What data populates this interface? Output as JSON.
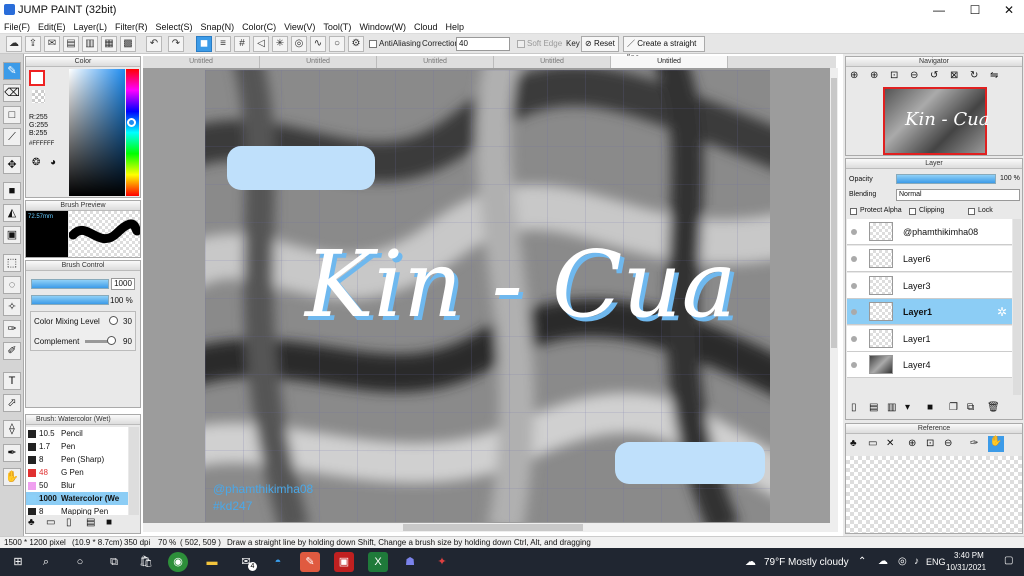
{
  "window": {
    "title": "JUMP PAINT (32bit)",
    "minimize": "—",
    "maximize": "☐",
    "close": "✕"
  },
  "menu": [
    "File(F)",
    "Edit(E)",
    "Layer(L)",
    "Filter(R)",
    "Select(S)",
    "Snap(N)",
    "Color(C)",
    "View(V)",
    "Tool(T)",
    "Window(W)",
    "Cloud",
    "Help"
  ],
  "toolbar": {
    "antialiasing_label": "AntiAliasing",
    "correction_label": "Correction",
    "correction_value": "40",
    "soft_edge_label": "Soft Edge",
    "key_label": "Key",
    "reset_label": "Reset",
    "straight_line_label": "Create a straight line"
  },
  "color_panel": {
    "title": "Color",
    "r": "R:255",
    "g": "G:255",
    "b": "B:255",
    "hex": "#FFFFFF"
  },
  "brush_preview": {
    "title": "Brush Preview",
    "size": "72.57mm"
  },
  "brush_control": {
    "title": "Brush Control",
    "size_value": "1000",
    "opacity_value": "100 %",
    "color_mixing_label": "Color Mixing Level",
    "color_mixing_value": "30",
    "complement_label": "Complement",
    "complement_value": "90"
  },
  "brush_list": {
    "title": "Brush: Watercolor (Wet)",
    "items": [
      {
        "size": "10.5",
        "name": "Pencil",
        "color": "#222222"
      },
      {
        "size": "1.7",
        "name": "Pen",
        "color": "#222222"
      },
      {
        "size": "8",
        "name": "Pen (Sharp)",
        "color": "#222222"
      },
      {
        "size": "48",
        "name": "G Pen",
        "color": "#e03030"
      },
      {
        "size": "50",
        "name": "Blur",
        "color": "#f0a0f0"
      },
      {
        "size": "1000",
        "name": "Watercolor (We",
        "color": "#8cd0f8"
      },
      {
        "size": "8",
        "name": "Mapping Pen",
        "color": "#222222"
      }
    ]
  },
  "tabs": [
    "Untitled",
    "Untitled",
    "Untitled",
    "Untitled",
    "Untitled"
  ],
  "artwork": {
    "main_text": "Kin - Cua",
    "credit_1": "@phamthikimha08",
    "credit_2": "#kd247"
  },
  "navigator": {
    "title": "Navigator",
    "thumb_text": "Kin - Cua"
  },
  "layer_panel": {
    "title": "Layer",
    "opacity_label": "Opacity",
    "opacity_value": "100 %",
    "blending_label": "Blending",
    "blending_value": "Normal",
    "protect_alpha": "Protect Alpha",
    "clipping": "Clipping",
    "lock": "Lock",
    "layers": [
      "@phamthikimha08",
      "Layer6",
      "Layer3",
      "Layer1",
      "Layer1",
      "Layer4"
    ]
  },
  "reference": {
    "title": "Reference"
  },
  "status": {
    "size": "1500 * 1200 pixel",
    "physical": "(10.9 * 8.7cm)",
    "dpi": "350 dpi",
    "zoom": "70 %",
    "coords": "( 502, 509 )",
    "hint": "Draw a straight line by holding down Shift, Change a brush size by holding down Ctrl, Alt, and dragging"
  },
  "taskbar": {
    "weather": "79°F  Mostly cloudy",
    "lang": "ENG",
    "time": "3:40 PM",
    "date": "10/31/2021",
    "mail_badge": "4"
  },
  "colors": {
    "accent": "#3c9be8",
    "art_blue": "#bfe0fb",
    "credit": "#4aa8e8"
  }
}
